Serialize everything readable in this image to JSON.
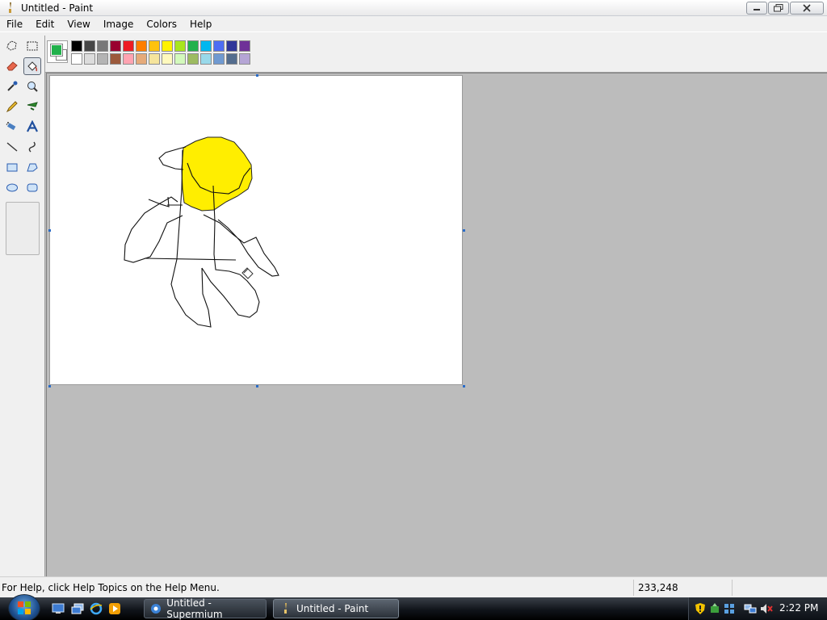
{
  "window": {
    "title": "Untitled - Paint"
  },
  "menu": [
    "File",
    "Edit",
    "View",
    "Image",
    "Colors",
    "Help"
  ],
  "tools": [
    "free-form-select",
    "select",
    "eraser",
    "fill-with-color",
    "pick-color",
    "magnifier",
    "pencil",
    "brush",
    "airbrush",
    "text",
    "line",
    "curve",
    "rectangle",
    "polygon",
    "ellipse",
    "rounded-rectangle"
  ],
  "colors": {
    "foreground": "#22b14c",
    "background": "#ffffff",
    "palette_top": [
      "#000000",
      "#464646",
      "#787878",
      "#990030",
      "#ed1c24",
      "#ff7e00",
      "#ffc20e",
      "#fff200",
      "#a8e61d",
      "#22b14c",
      "#00b7ef",
      "#4d6df3",
      "#2f3699",
      "#6f3198"
    ],
    "palette_bottom": [
      "#ffffff",
      "#dcdcdc",
      "#b4b4b4",
      "#9c5a3c",
      "#ffa3b1",
      "#e5aa7a",
      "#f5e49c",
      "#fff9bd",
      "#d3f9bc",
      "#9dbb61",
      "#99d9ea",
      "#709ad1",
      "#546d8e",
      "#b5a5d5"
    ]
  },
  "status": {
    "help": "For Help, click Help Topics on the Help Menu.",
    "coords": "233,248"
  },
  "taskbar": {
    "buttons": [
      {
        "label": "Untitled - Supermium",
        "active": false
      },
      {
        "label": "Untitled - Paint",
        "active": true
      }
    ],
    "clock": "2:22 PM"
  }
}
